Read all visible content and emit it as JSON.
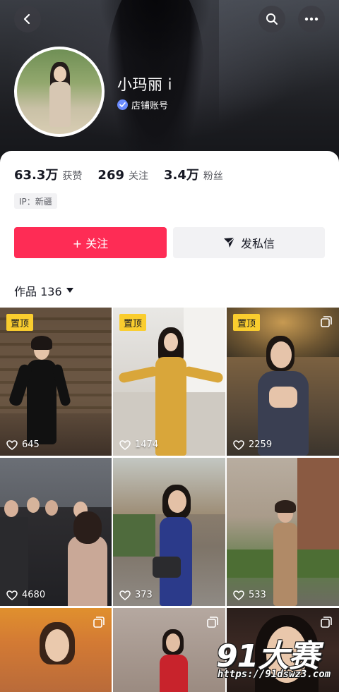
{
  "profile": {
    "name": "小玛丽 i",
    "badge_label": "店铺账号"
  },
  "stats": [
    {
      "value": "63.3万",
      "label": "获赞"
    },
    {
      "value": "269",
      "label": "关注"
    },
    {
      "value": "3.4万",
      "label": "粉丝"
    }
  ],
  "ip_label": "IP：新疆",
  "actions": {
    "follow_label": "+ 关注",
    "message_label": "发私信"
  },
  "works": {
    "label": "作品 136"
  },
  "videos": [
    {
      "pinned": true,
      "pin_label": "置顶",
      "likes": "645",
      "multi": false
    },
    {
      "pinned": true,
      "pin_label": "置顶",
      "likes": "1474",
      "multi": false
    },
    {
      "pinned": true,
      "pin_label": "置顶",
      "likes": "2259",
      "multi": true
    },
    {
      "pinned": false,
      "likes": "4680",
      "multi": false
    },
    {
      "pinned": false,
      "likes": "373",
      "multi": false
    },
    {
      "pinned": false,
      "likes": "533",
      "multi": false
    },
    {
      "pinned": false,
      "likes": "",
      "multi": true
    },
    {
      "pinned": false,
      "likes": "",
      "multi": true
    },
    {
      "pinned": false,
      "likes": "",
      "multi": true
    }
  ],
  "watermark": {
    "logo": "91大赛",
    "url": "https://91dswz3.com"
  },
  "colors": {
    "accent": "#fe2c55",
    "pin": "#facd2e",
    "verify": "#6b8cff"
  },
  "icons": {
    "back": "chevron-left-icon",
    "search": "search-icon",
    "more": "more-icon",
    "verify": "verified-icon",
    "message": "send-icon",
    "dropdown": "caret-down-icon",
    "heart": "heart-icon",
    "multi": "multi-image-icon"
  }
}
